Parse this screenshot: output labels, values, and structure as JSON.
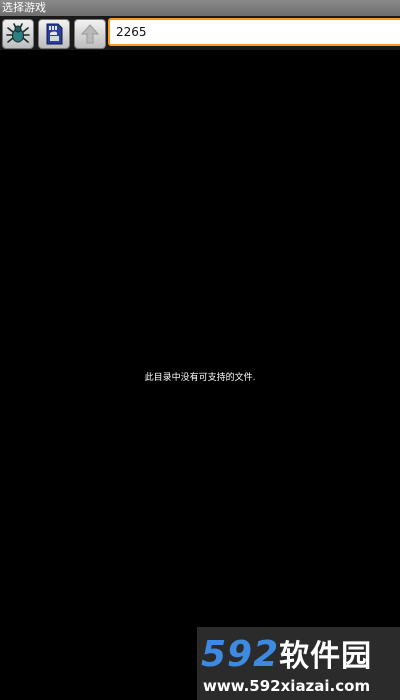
{
  "title_bar": {
    "title": "选择游戏"
  },
  "toolbar": {
    "buttons": [
      {
        "icon": "bug-icon"
      },
      {
        "icon": "sd-card-icon"
      },
      {
        "icon": "arrow-up-icon"
      }
    ],
    "path_value": "2265"
  },
  "main": {
    "empty_message": "此目录中没有可支持的文件."
  },
  "watermark": {
    "logo_number": "592",
    "logo_text": "软件园",
    "url": "www.592xiazai.com"
  },
  "colors": {
    "background": "#000000",
    "input_border": "#ff9a1e",
    "watermark_blue": "#3d8be0"
  }
}
